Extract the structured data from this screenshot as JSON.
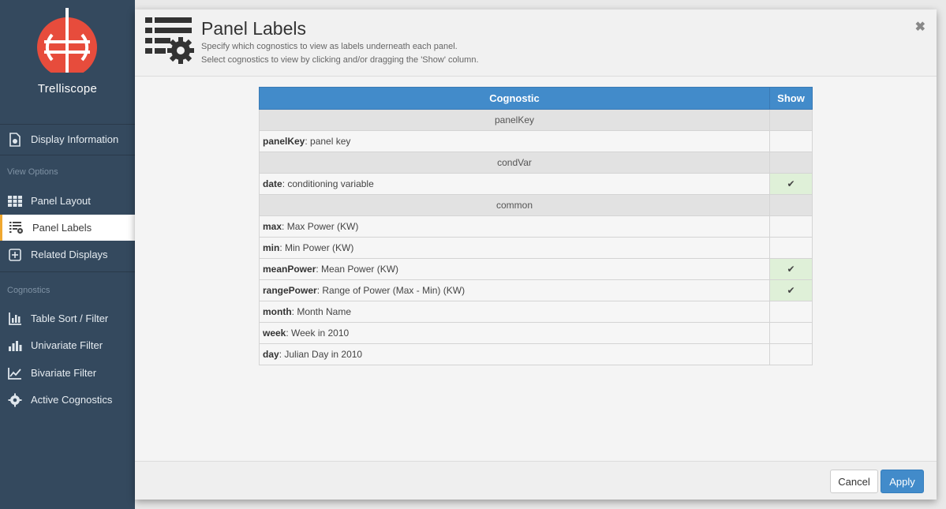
{
  "app": {
    "brand": "Trelliscope"
  },
  "sidebar": {
    "display_info": "Display Information",
    "view_options_section": "View Options",
    "panel_layout": "Panel Layout",
    "panel_labels": "Panel Labels",
    "related_displays": "Related Displays",
    "cognostics_section": "Cognostics",
    "table_sort_filter": "Table Sort / Filter",
    "univariate_filter": "Univariate Filter",
    "bivariate_filter": "Bivariate Filter",
    "active_cognostics": "Active Cognostics"
  },
  "modal": {
    "title": "Panel Labels",
    "description_1": "Specify which cognostics to view as labels underneath each panel.",
    "description_2": "Select cognostics to view by clicking and/or dragging the 'Show' column.",
    "close_symbol": "✖",
    "cancel_label": "Cancel",
    "apply_label": "Apply"
  },
  "table": {
    "header_cognostic": "Cognostic",
    "header_show": "Show",
    "check_symbol": "✔",
    "groups": [
      {
        "label": "panelKey",
        "rows": [
          {
            "name": "panelKey",
            "desc": ": panel key",
            "show": false
          }
        ]
      },
      {
        "label": "condVar",
        "rows": [
          {
            "name": "date",
            "desc": ": conditioning variable",
            "show": true
          }
        ]
      },
      {
        "label": "common",
        "rows": [
          {
            "name": "max",
            "desc": ": Max Power (KW)",
            "show": false
          },
          {
            "name": "min",
            "desc": ": Min Power (KW)",
            "show": false
          },
          {
            "name": "meanPower",
            "desc": ": Mean Power (KW)",
            "show": true
          },
          {
            "name": "rangePower",
            "desc": ": Range of Power (Max - Min) (KW)",
            "show": true
          },
          {
            "name": "month",
            "desc": ": Month Name",
            "show": false
          },
          {
            "name": "week",
            "desc": ": Week in 2010",
            "show": false
          },
          {
            "name": "day",
            "desc": ": Julian Day in 2010",
            "show": false
          }
        ]
      }
    ]
  },
  "colors": {
    "sidebar_bg": "#34495e",
    "accent": "#428bca",
    "active_marker": "#f0a830",
    "show_on_bg": "#dff0d8",
    "logo_red": "#e74c3c"
  }
}
